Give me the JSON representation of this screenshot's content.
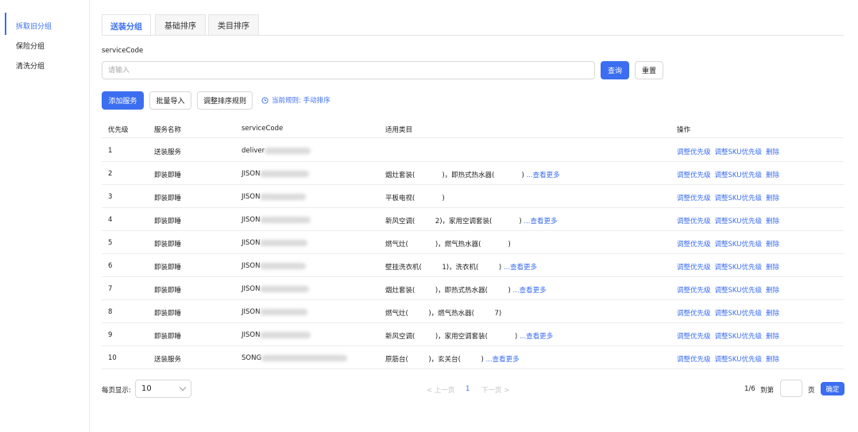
{
  "sidebar": {
    "items": [
      {
        "label": "拆取旧分组",
        "active": true
      },
      {
        "label": "保险分组",
        "active": false
      },
      {
        "label": "清洗分组",
        "active": false
      }
    ]
  },
  "tabs": [
    {
      "label": "送装分组",
      "active": true
    },
    {
      "label": "基础排序",
      "active": false
    },
    {
      "label": "类目排序",
      "active": false
    }
  ],
  "search": {
    "label": "serviceCode",
    "placeholder": "请输入",
    "value": "",
    "query_label": "查询",
    "reset_label": "重置"
  },
  "toolbar": {
    "add_label": "添加服务",
    "import_label": "批量导入",
    "adjust_rule_label": "调整排序规则",
    "current_rule": "当前规则: 手动排序"
  },
  "table": {
    "columns": [
      "优先级",
      "服务名称",
      "serviceCode",
      "适用类目",
      "操作"
    ],
    "rows": [
      {
        "priority": "1",
        "name": "送装服务",
        "code": "deliver",
        "category": "",
        "more": ""
      },
      {
        "priority": "2",
        "name": "即装即睡",
        "code": "JISON",
        "category": "烟灶套装(　　　　)，即热式热水器(　　　　)",
        "more": "...查看更多"
      },
      {
        "priority": "3",
        "name": "即装即睡",
        "code": "JISON",
        "category": "平板电视(　　　　)",
        "more": ""
      },
      {
        "priority": "4",
        "name": "即装即睡",
        "code": "JISON",
        "category": "新风空调(　　　2)，家用空调套装(　　　　)",
        "more": "...查看更多"
      },
      {
        "priority": "5",
        "name": "即装即睡",
        "code": "JISON",
        "category": "燃气灶(　　　　)，燃气热水器(　　　　)",
        "more": ""
      },
      {
        "priority": "6",
        "name": "即装即睡",
        "code": "JISON",
        "category": "壁挂洗衣机(　　　1)，洗衣机(　　　)",
        "more": "...查看更多"
      },
      {
        "priority": "7",
        "name": "即装即睡",
        "code": "JISON",
        "category": "烟灶套装(　　　)，即热式热水器(　　　)",
        "more": "...查看更多"
      },
      {
        "priority": "8",
        "name": "即装即睡",
        "code": "JISON",
        "category": "燃气灶(　　　)，燃气热水器(　　　7)",
        "more": ""
      },
      {
        "priority": "9",
        "name": "即装即睡",
        "code": "JISON",
        "category": "新风空调(　　　)，家用空调套装(　　　　)",
        "more": "...查看更多"
      },
      {
        "priority": "10",
        "name": "送装服务",
        "code": "SONG",
        "category": "原筋台(　　　)，玄关台(　　　)",
        "more": "...查看更多"
      }
    ],
    "ops": {
      "adjust_priority": "调整优先级",
      "adjust_sku": "调整SKU优先级",
      "delete": "删除"
    }
  },
  "pagination": {
    "per_page_label": "每页显示:",
    "per_page_value": "10",
    "prev_label": "< 上一页",
    "current_page": "1",
    "next_label": "下一页 >",
    "total": "1/6",
    "goto_label": "到第",
    "page_unit": "页",
    "confirm_label": "确定"
  },
  "colors": {
    "accent": "#3b6ef0"
  }
}
